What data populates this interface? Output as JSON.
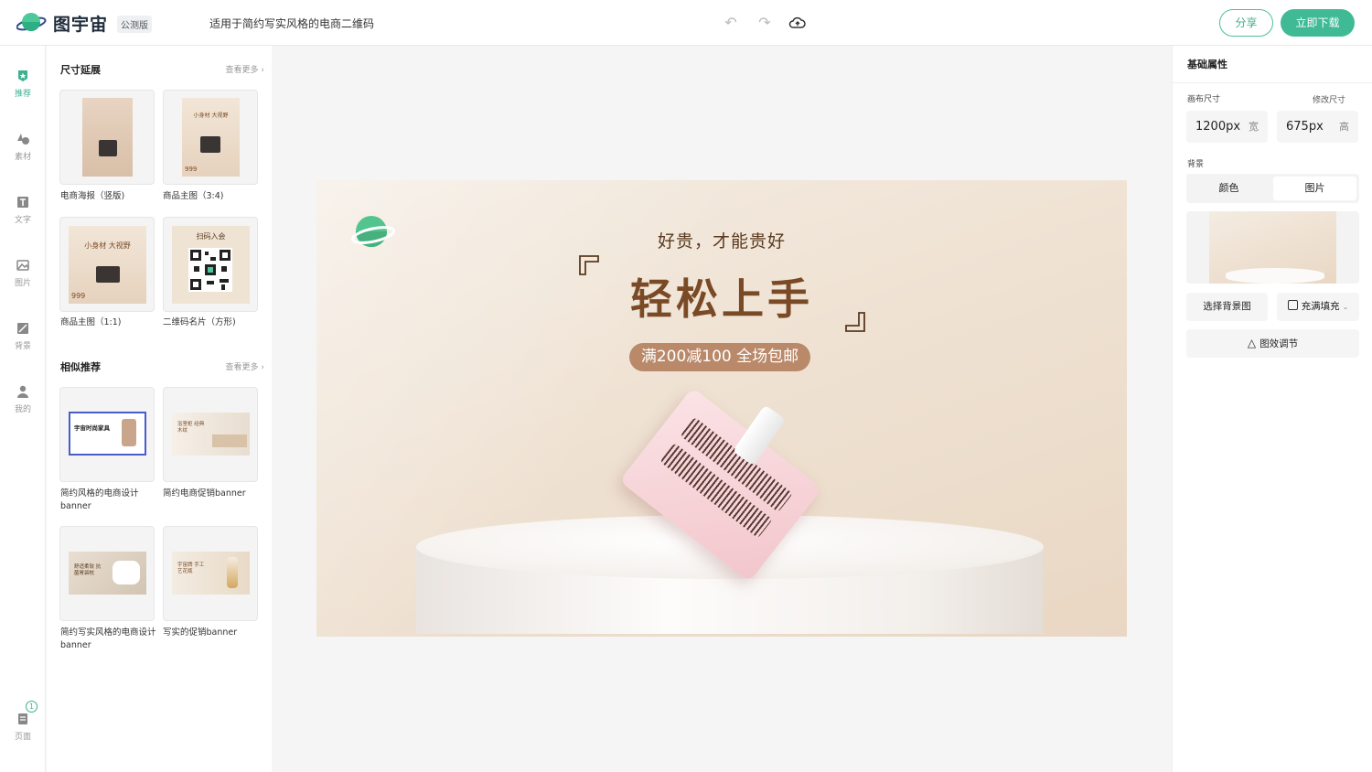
{
  "header": {
    "brand": "图宇宙",
    "beta_badge": "公测版",
    "doc_title": "适用于简约写实风格的电商二维码",
    "share_label": "分享",
    "download_label": "立即下载",
    "icons": [
      "undo-icon",
      "redo-icon",
      "cloud-upload-icon"
    ]
  },
  "leftnav": {
    "items": [
      {
        "label": "推荐",
        "icon": "star-icon",
        "active": true
      },
      {
        "label": "素材",
        "icon": "shapes-icon"
      },
      {
        "label": "文字",
        "icon": "text-icon"
      },
      {
        "label": "图片",
        "icon": "image-icon"
      },
      {
        "label": "背景",
        "icon": "background-icon"
      },
      {
        "label": "我的",
        "icon": "user-icon"
      }
    ],
    "pages_label": "页面",
    "pages_count": "1"
  },
  "panel": {
    "section1": {
      "title": "尺寸延展",
      "more": "查看更多",
      "cards": [
        {
          "label": "电商海报（竖版)"
        },
        {
          "label": "商品主图（3:4)"
        },
        {
          "label": "商品主图（1:1)"
        },
        {
          "label": "二维码名片（方形)"
        }
      ]
    },
    "section2": {
      "title": "相似推荐",
      "more": "查看更多",
      "cards": [
        {
          "label": "简约风格的电商设计banner"
        },
        {
          "label": "简约电商促销banner"
        },
        {
          "label": "简约写实风格的电商设计banner"
        },
        {
          "label": "写实的促销banner"
        }
      ]
    },
    "thumb_text": {
      "poster_line1": "小身材 大视野",
      "price": "999",
      "qr_title": "扫码入会",
      "b1_title": "宇宙时尚家具",
      "b2_title": "浴室柜 经典木纹",
      "b3_title": "舒适柔软 抗菌胃袋枕",
      "b4_title": "宇宙牌 手工艺花瓶"
    }
  },
  "design": {
    "subtitle": "好贵，才能贵好",
    "headline": "轻松上手",
    "promo": "满200减100 全场包邮"
  },
  "rightpanel": {
    "title": "基础属性",
    "canvas_size_label": "画布尺寸",
    "resize_label": "修改尺寸",
    "width_value": "1200px",
    "width_unit": "宽",
    "height_value": "675px",
    "height_unit": "高",
    "background_label": "背景",
    "tab_color": "颜色",
    "tab_image": "图片",
    "choose_bg": "选择背景图",
    "fill_mode": "充满填充",
    "effects": "图效调节"
  },
  "colors": {
    "accent": "#3fba94",
    "promo_pill": "#b9896a",
    "headline": "#7a4a26"
  }
}
